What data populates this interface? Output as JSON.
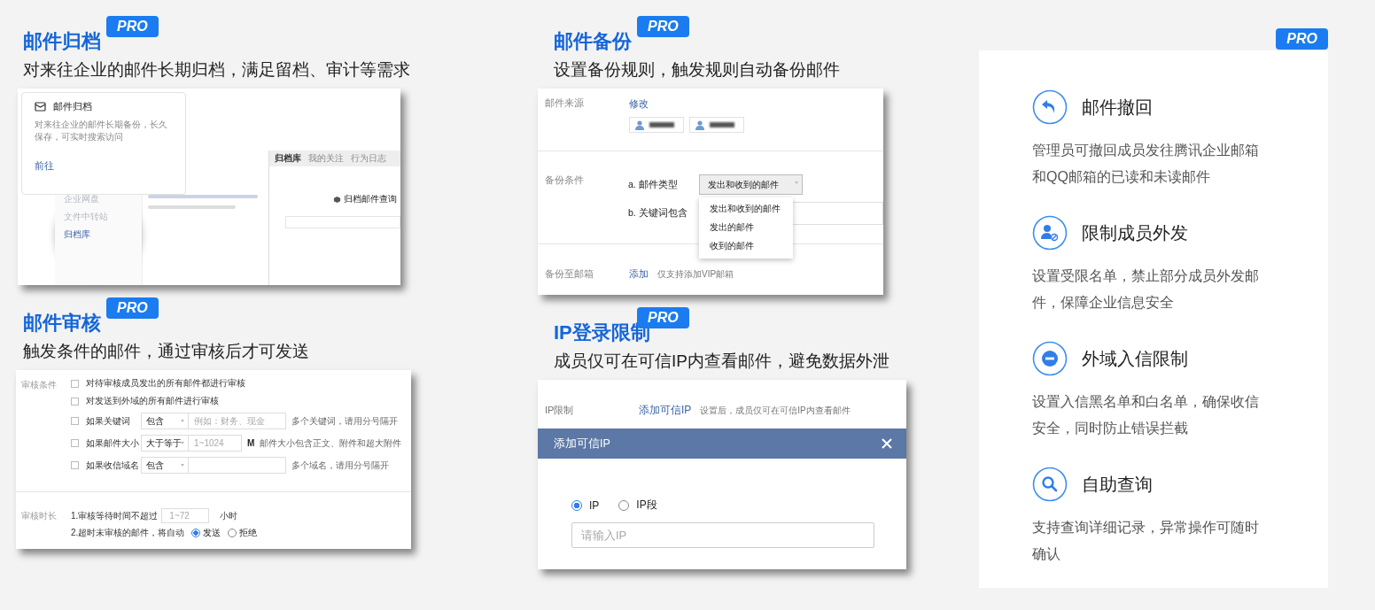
{
  "left_column": {
    "archive": {
      "title": "邮件归档",
      "badge": "PRO",
      "subtitle": "对来往企业的邮件长期归档，满足留档、审计等需求",
      "card": {
        "title": "邮件归档",
        "description": "对来往企业的邮件长期备份，长久保存，可实时搜索访问",
        "link": "前往"
      },
      "sidebar_items": [
        {
          "label": "企业网盘",
          "selected": false
        },
        {
          "label": "文件中转站",
          "selected": false
        },
        {
          "label": "归档库",
          "selected": true
        }
      ],
      "tabs": [
        {
          "label": "归档库",
          "selected": true
        },
        {
          "label": "我的关注",
          "selected": false
        },
        {
          "label": "行为日志",
          "selected": false
        }
      ],
      "search_title": "归档邮件查询"
    },
    "review": {
      "title": "邮件审核",
      "badge": "PRO",
      "subtitle": "触发条件的邮件，通过审核后才可发送",
      "conditions_label": "审核条件",
      "conditions": [
        {
          "kind": "checkbox",
          "label": "对待审核成员发出的所有邮件都进行审核",
          "checked": false
        },
        {
          "kind": "checkbox",
          "label": "对发送到外域的所有邮件进行审核",
          "checked": false
        },
        {
          "kind": "filter",
          "label": "如果关键词",
          "checked": false,
          "select": "包含",
          "placeholder": "例如：财务、现金",
          "hint": "多个关键词，请用分号隔开"
        },
        {
          "kind": "filter",
          "label": "如果邮件大小",
          "checked": false,
          "select": "大于等于",
          "placeholder": "1~1024",
          "unit": "M",
          "hint": "邮件大小包含正文、附件和超大附件"
        },
        {
          "kind": "filter",
          "label": "如果收信域名",
          "checked": false,
          "select": "包含",
          "hint": "多个域名，请用分号隔开"
        }
      ],
      "duration_label": "审核时长",
      "wait_text": "1.审核等待时间不超过",
      "wait_placeholder": "1~72",
      "wait_unit": "小时",
      "timeout_text": "2.超时未审核的邮件，将自动",
      "timeout_options": [
        {
          "label": "发送",
          "selected": true
        },
        {
          "label": "拒绝",
          "selected": false
        }
      ]
    }
  },
  "middle_column": {
    "backup": {
      "title": "邮件备份",
      "badge": "PRO",
      "subtitle": "设置备份规则，触发规则自动备份邮件",
      "source_label": "邮件来源",
      "source_link": "修改",
      "condition_label": "备份条件",
      "type_label": "a. 邮件类型",
      "type_value": "发出和收到的邮件",
      "type_options": [
        "发出和收到的邮件",
        "发出的邮件",
        "收到的邮件"
      ],
      "keyword_label": "b. 关键词包含",
      "target_label": "备份至邮箱",
      "target_link": "添加",
      "target_hint": "仅支持添加VIP邮箱"
    },
    "ip_limit": {
      "title": "IP登录限制",
      "badge": "PRO",
      "subtitle": "成员仅可在可信IP内查看邮件，避免数据外泄",
      "row_label": "IP限制",
      "row_link": "添加可信IP",
      "row_hint": "设置后，成员仅可在可信IP内查看邮件",
      "dialog_title": "添加可信IP",
      "modes": [
        {
          "label": "IP",
          "selected": true
        },
        {
          "label": "IP段",
          "selected": false
        }
      ],
      "placeholder": "请输入IP"
    }
  },
  "right_panel": {
    "badge": "PRO",
    "features": [
      {
        "kind": "undo",
        "title": "邮件撤回",
        "description": "管理员可撤回成员发往腾讯企业邮箱和QQ邮箱的已读和未读邮件"
      },
      {
        "kind": "user-block",
        "title": "限制成员外发",
        "description": "设置受限名单，禁止部分成员外发邮件，保障企业信息安全"
      },
      {
        "kind": "minus",
        "title": "外域入信限制",
        "description": "设置入信黑名单和白名单，确保收信安全，同时防止错误拦截"
      },
      {
        "kind": "search",
        "title": "自助查询",
        "description": "支持查询详细记录，异常操作可随时确认"
      }
    ]
  }
}
